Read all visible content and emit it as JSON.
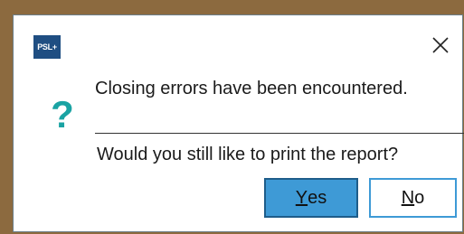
{
  "app_icon": {
    "text": "PSL+"
  },
  "titlebar": {
    "close_glyph": "✕"
  },
  "icon": {
    "glyph": "?",
    "color": "#1aa3a3",
    "name": "question-icon"
  },
  "message": {
    "main": "Closing errors have been encountered.",
    "question": "Would you still like to print the report?"
  },
  "buttons": {
    "yes": {
      "mnemonic": "Y",
      "rest": "es"
    },
    "no": {
      "mnemonic": "N",
      "rest": "o"
    }
  },
  "colors": {
    "accent": "#3e9ad6",
    "icon_teal": "#1aa3a3",
    "app_icon_bg": "#1f4e82",
    "background": "#8c6a3f"
  }
}
